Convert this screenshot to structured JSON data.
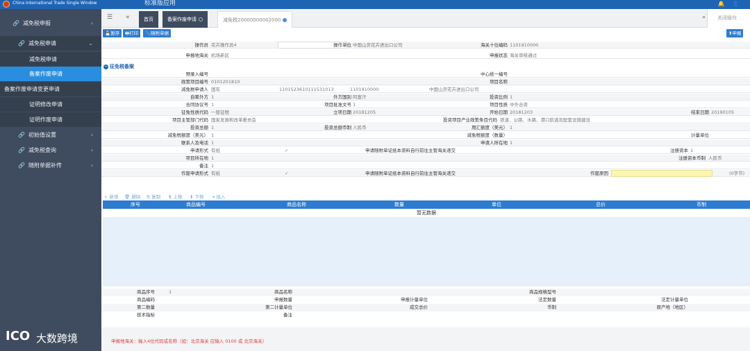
{
  "app": {
    "brand": "China International Trade Single Window",
    "system_name": "标准版应用"
  },
  "top_icons": [
    "bell-icon",
    "user-icon",
    "power-icon"
  ],
  "sidebar": {
    "items": [
      {
        "label": "减免税申报",
        "arrow": "‹"
      },
      {
        "label": "减免税申请",
        "arrow": "⌄"
      },
      {
        "label": "减免税申请"
      },
      {
        "label": "备案作废申请"
      },
      {
        "label": "备案作废申请变更申请",
        "highlight": "备案作废申请"
      },
      {
        "label": "证明修改申请"
      },
      {
        "label": "证明作废申请"
      },
      {
        "label": "初始值设置",
        "arrow": "‹"
      },
      {
        "label": "减免税查询",
        "arrow": "‹"
      },
      {
        "label": "随附单据补传",
        "arrow": "‹"
      }
    ]
  },
  "tabs": {
    "menu_icon": "☰",
    "back_icon": "«",
    "forward_icon": "»",
    "home": "首页",
    "tab1": "备案作废申请",
    "tab2": "减免税20000000002000",
    "close_all": "关闭操作"
  },
  "toolbar": {
    "save": "暂存",
    "print": "打印",
    "attach": "随附单据",
    "submit": "申报"
  },
  "form": {
    "operator_label": "操作员",
    "operator": "花卉操作员4",
    "unit_label": "操作单位",
    "unit": "中国山货花卉进出口公司",
    "customs_code_label": "海关十位编码",
    "customs_code": "1101910000",
    "decl_customs_label": "申报地海关",
    "decl_customs": "机场新区",
    "decl_status_label": "申报状态",
    "decl_status": "海关审核通过",
    "section": "征免税备案",
    "pre_entry_label": "预录入编号",
    "center_no_label": "中心统一编号",
    "policy_no_label": "政策项目编号",
    "policy_no": "0101201810",
    "project_name_label": "项目名称",
    "applicant_label": "减免税申请人",
    "applicant_1": "国有",
    "applicant_2": "1101523610111531013",
    "applicant_3": "1101910000",
    "applicant_4": "中国山货花卉进出口公司",
    "own_out_label": "自筹外方",
    "own_out": "1",
    "foreign_country_label": "外方国别",
    "foreign_country": "阿富汗",
    "invest_ratio_label": "投资比例",
    "invest_ratio": "1",
    "contract_no_label": "合同协议号",
    "contract_no": "1",
    "approval_no_label": "项目批准文号",
    "approval_no": "1",
    "project_nature_label": "项目性质",
    "project_nature": "中外合资",
    "tax_code_label": "征免性质代码",
    "tax_code": "一般征税",
    "setup_date_label": "立项日期",
    "setup_date": "20181205",
    "start_date_label": "开始日期",
    "start_date": "20181203",
    "end_date_label": "结束日期",
    "end_date": "20190105",
    "dept_label": "项目主管部门代码",
    "dept": "国家发展和改革委员会",
    "industry_label": "投资项目产业政策条目代码",
    "industry": "铁道、公路、水路、港口航道及配套设施建设",
    "total_invest_label": "投资总额",
    "total_invest": "1",
    "currency_label": "投资总额币制",
    "currency": "人民币",
    "usd_quota_label": "用汇额度（美元）",
    "usd_quota": "1",
    "reduce_usd_label": "减免税额度（美元）",
    "reduce_usd": "1",
    "reduce_qty_label": "减免税额度（数量）",
    "unit_measure_label": "计量单位",
    "contact_label": "联系人及电话",
    "contact": "1",
    "applicant_loc_label": "申请人所在地",
    "applicant_loc": "1",
    "apply_form_label": "申请形式",
    "apply_form": "有纸",
    "check_mark": "✓",
    "apply_attach_label": "申请随附单证纸本资料自行前往主管海关递交",
    "reg_capital_label": "注册资本",
    "reg_capital": "1",
    "project_loc_label": "项目所在地",
    "project_loc": "1",
    "reg_currency_label": "注册资本币制",
    "reg_currency": "人民币",
    "remark_label": "备注",
    "remark": "1",
    "void_form_label": "作废申请形式",
    "void_form": "有纸",
    "void_attach_label": "申请随附单证纸本资料自行前往主管海关递交",
    "void_reason_label": "作废原因",
    "char_count": "(0字节)"
  },
  "grid": {
    "buttons": [
      "新增",
      "删除",
      "复制",
      "上移",
      "下移",
      "插入"
    ],
    "columns": [
      "序号",
      "商品编号",
      "商品名称",
      "数量",
      "单位",
      "总价",
      "币制"
    ],
    "empty": "暂无数据"
  },
  "detail": {
    "item_no_label": "商品序号",
    "item_no": "1",
    "item_name_label": "商品名称",
    "spec_label": "商品规格型号",
    "code_label": "商品编码",
    "decl_qty_label": "申报数量",
    "decl_unit_label": "申报计量单位",
    "legal_qty_label": "法定数量",
    "legal_unit_label": "法定计量单位",
    "second_qty_label": "第二数量",
    "second_unit_label": "第二计量单位",
    "total_price_label": "成交总价",
    "currency_label": "币制",
    "origin_label": "原产地（地区）",
    "tech_label": "技术指标",
    "remark_label": "备注"
  },
  "footer": {
    "warning": "申报地海关：输入4位代码或名称（如：北京海关 应输入 0100 或 北京海关）"
  },
  "watermark": {
    "logo": "ICO",
    "text": "大数跨境"
  }
}
